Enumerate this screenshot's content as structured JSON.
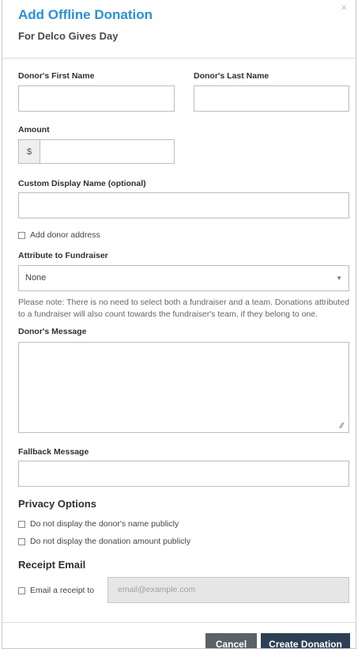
{
  "modal": {
    "title": "Add Offline Donation",
    "subtitle": "For Delco Gives Day",
    "close_glyph": "×"
  },
  "form": {
    "first_name_label": "Donor's First Name",
    "last_name_label": "Donor's Last Name",
    "amount_label": "Amount",
    "currency_symbol": "$",
    "display_name_label": "Custom Display Name (optional)",
    "add_address_label": "Add donor address",
    "fundraiser_label": "Attribute to Fundraiser",
    "fundraiser_selected": "None",
    "fundraiser_note": "Please note: There is no need to select both a fundraiser and a team. Donations attributed to a fundraiser will also count towards the fundraiser's team, if they belong to one.",
    "message_label": "Donor's Message",
    "fallback_label": "Fallback Message"
  },
  "privacy": {
    "heading": "Privacy Options",
    "hide_name_label": "Do not display the donor's name publicly",
    "hide_amount_label": "Do not display the donation amount publicly"
  },
  "receipt": {
    "heading": "Receipt Email",
    "email_label": "Email a receipt to",
    "email_placeholder": "email@example.com"
  },
  "footer": {
    "cancel_label": "Cancel",
    "create_label": "Create Donation"
  },
  "colors": {
    "title": "#2b8fd6",
    "primary_button": "#2d3f55",
    "secondary_button": "#5c6168"
  }
}
